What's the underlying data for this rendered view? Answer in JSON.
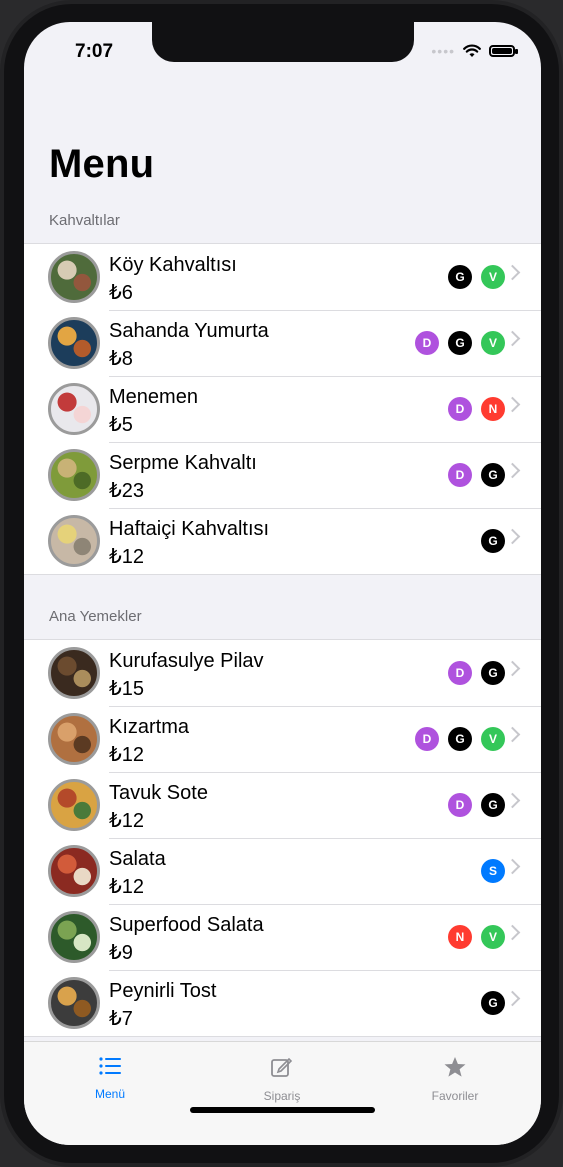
{
  "status": {
    "time": "7:07"
  },
  "page": {
    "title": "Menu"
  },
  "sections": [
    {
      "header": "Kahvaltılar",
      "items": [
        {
          "name": "Köy Kahvaltısı",
          "price": "₺6",
          "badges": [
            {
              "letter": "G",
              "color": "#000000"
            },
            {
              "letter": "V",
              "color": "#34c759"
            }
          ],
          "thumb": [
            "#4f6b3b",
            "#d7cbb4",
            "#93573d"
          ]
        },
        {
          "name": "Sahanda Yumurta",
          "price": "₺8",
          "badges": [
            {
              "letter": "D",
              "color": "#af52de"
            },
            {
              "letter": "G",
              "color": "#000000"
            },
            {
              "letter": "V",
              "color": "#34c759"
            }
          ],
          "thumb": [
            "#1c3d5b",
            "#e2a543",
            "#b35b2b"
          ]
        },
        {
          "name": "Menemen",
          "price": "₺5",
          "badges": [
            {
              "letter": "D",
              "color": "#af52de"
            },
            {
              "letter": "N",
              "color": "#ff3b30"
            }
          ],
          "thumb": [
            "#e9e8ec",
            "#c23b3b",
            "#f4d5d5"
          ]
        },
        {
          "name": "Serpme Kahvaltı",
          "price": "₺23",
          "badges": [
            {
              "letter": "D",
              "color": "#af52de"
            },
            {
              "letter": "G",
              "color": "#000000"
            }
          ],
          "thumb": [
            "#7f9b3a",
            "#c8b276",
            "#4d6b26"
          ]
        },
        {
          "name": "Haftaiçi Kahvaltısı",
          "price": "₺12",
          "badges": [
            {
              "letter": "G",
              "color": "#000000"
            }
          ],
          "thumb": [
            "#c7b8a6",
            "#e5d27a",
            "#8e8576"
          ]
        }
      ]
    },
    {
      "header": "Ana Yemekler",
      "items": [
        {
          "name": "Kurufasulye Pilav",
          "price": "₺15",
          "badges": [
            {
              "letter": "D",
              "color": "#af52de"
            },
            {
              "letter": "G",
              "color": "#000000"
            }
          ],
          "thumb": [
            "#3a2a1f",
            "#6b4b2f",
            "#aa8d5c"
          ]
        },
        {
          "name": "Kızartma",
          "price": "₺12",
          "badges": [
            {
              "letter": "D",
              "color": "#af52de"
            },
            {
              "letter": "G",
              "color": "#000000"
            },
            {
              "letter": "V",
              "color": "#34c759"
            }
          ],
          "thumb": [
            "#b07040",
            "#d9a06a",
            "#5b3a22"
          ]
        },
        {
          "name": "Tavuk Sote",
          "price": "₺12",
          "badges": [
            {
              "letter": "D",
              "color": "#af52de"
            },
            {
              "letter": "G",
              "color": "#000000"
            }
          ],
          "thumb": [
            "#d9a343",
            "#b44a2a",
            "#4a7a3a"
          ]
        },
        {
          "name": "Salata",
          "price": "₺12",
          "badges": [
            {
              "letter": "S",
              "color": "#007aff"
            }
          ],
          "thumb": [
            "#8b2a21",
            "#d25b3a",
            "#e9d9c5"
          ]
        },
        {
          "name": "Superfood Salata",
          "price": "₺9",
          "badges": [
            {
              "letter": "N",
              "color": "#ff3b30"
            },
            {
              "letter": "V",
              "color": "#34c759"
            }
          ],
          "thumb": [
            "#2d5a2a",
            "#7ba352",
            "#d7e6c4"
          ]
        },
        {
          "name": "Peynirli Tost",
          "price": "₺7",
          "badges": [
            {
              "letter": "G",
              "color": "#000000"
            }
          ],
          "thumb": [
            "#3c3c3c",
            "#d9a24c",
            "#8f5a22"
          ]
        }
      ]
    }
  ],
  "tabs": [
    {
      "label": "Menü",
      "icon": "list-icon",
      "active": true
    },
    {
      "label": "Sipariş",
      "icon": "compose-icon",
      "active": false
    },
    {
      "label": "Favoriler",
      "icon": "star-icon",
      "active": false
    }
  ],
  "colors": {
    "accent": "#007aff",
    "inactive": "#8e8e93"
  }
}
